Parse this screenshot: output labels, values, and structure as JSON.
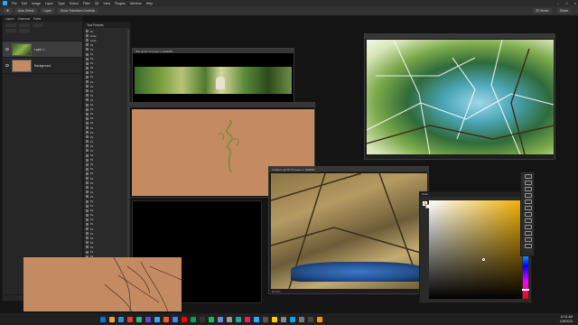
{
  "menubar": {
    "items": [
      "File",
      "Edit",
      "Image",
      "Layer",
      "Type",
      "Select",
      "Filter",
      "3D",
      "View",
      "Plugins",
      "Window",
      "Help"
    ]
  },
  "options": {
    "buttons": [
      "Auto-Select:",
      "Layer",
      "Show Transform Controls"
    ],
    "right": [
      "3D Mode:",
      "Share"
    ]
  },
  "layers_panel": {
    "tabs": [
      "Layers",
      "Channels",
      "Paths"
    ],
    "layers": [
      {
        "name": "Layer 1",
        "thumb": "forest",
        "selected": true
      },
      {
        "name": "Background",
        "thumb": "orange",
        "selected": false
      }
    ]
  },
  "tool_presets": {
    "title": "Tool Presets",
    "items": [
      "Ps",
      "circle",
      "circle",
      "Ps",
      "Ps",
      "Ps",
      "Ps",
      "Ps",
      "Ps",
      "Ps",
      "Ps",
      "Ps",
      "Ps",
      "Ps",
      "Ps",
      "Ps",
      "Ps",
      "Ps",
      "Ps",
      "Ps",
      "Ps",
      "Ps",
      "Ps",
      "Ps",
      "Ps",
      "Ps",
      "Ps",
      "Ps",
      "Ps",
      "Ps",
      "Ps",
      "Ps",
      "Ps",
      "Ps",
      "Ps",
      "Ps",
      "Ps",
      "Ps",
      "Ps",
      "Ps",
      "Ps",
      "Ps",
      "Ps",
      "Ps",
      "Ps",
      "Ps",
      "Ps",
      "Ps",
      "Ps",
      "Ps",
      "Ps",
      "Ps",
      "Ps",
      "Ps"
    ],
    "footer": "Current Tool Only"
  },
  "windows": {
    "win1_title": "JPG @ 66.7% (Layer 1, RGB/8#)",
    "win2_title": "",
    "win3_title": "",
    "win3_status": "",
    "win4_title": "Untitled-1 @ 66.7% (Layer 1, RGB/8#)",
    "win4_status": "66.67%"
  },
  "color_picker": {
    "title": "Color",
    "fg": "#e7c15a",
    "bg": "#ffffff"
  },
  "taskbar": {
    "time": "12:01 AM",
    "date": "1/26/2024",
    "icons": [
      "#0078d4",
      "#e8a33d",
      "#2f8fd8",
      "#d8402f",
      "#36b37e",
      "#6f42c1",
      "#31a8ff",
      "#f05a28",
      "#4285f4",
      "#ff0000",
      "#0f9d58",
      "#333333",
      "#1db954",
      "#7289da",
      "#999999",
      "#2aa198",
      "#e91e63",
      "#31a8ff",
      "#555555",
      "#ffcc00",
      "#888888",
      "#00a4ef",
      "#777777",
      "#444444",
      "#ff9800"
    ]
  }
}
